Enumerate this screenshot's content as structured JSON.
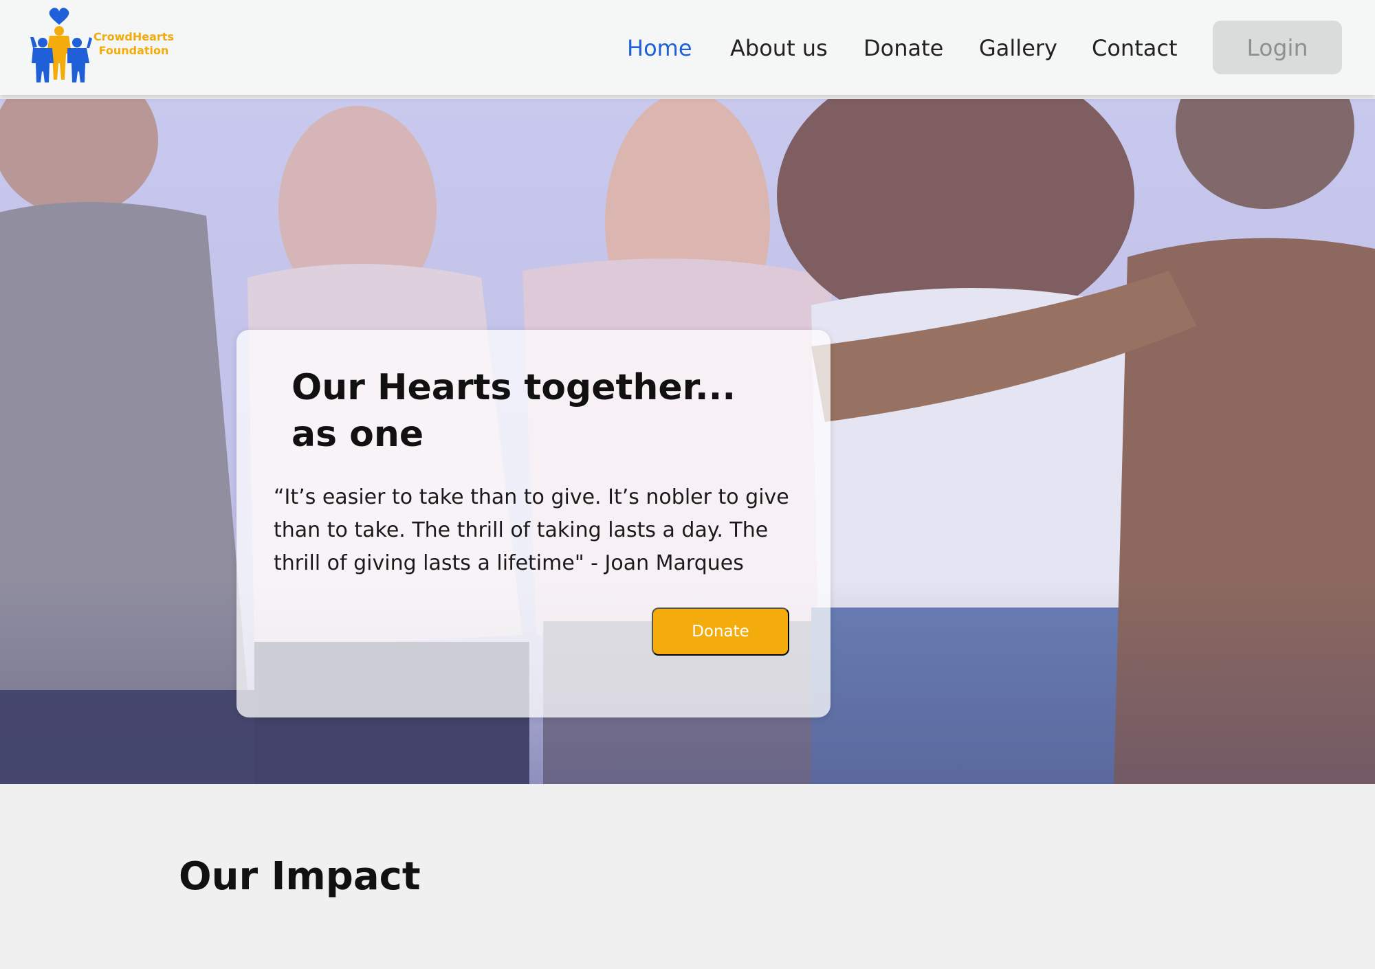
{
  "brand": {
    "name_line1": "CrowdHearts",
    "name_line2": "Foundation",
    "logo_icon": "heart-family-icon",
    "accent_color": "#f4ac0c",
    "primary_color": "#1f5fd8"
  },
  "nav": {
    "items": [
      {
        "label": "Home",
        "active": true
      },
      {
        "label": "About us",
        "active": false
      },
      {
        "label": "Donate",
        "active": false
      },
      {
        "label": "Gallery",
        "active": false
      },
      {
        "label": "Contact",
        "active": false
      }
    ],
    "login_label": "Login"
  },
  "hero": {
    "title": "Our Hearts together... as one",
    "quote": "“It’s easier to take than to give. It’s nobler to give than to take. The thrill of taking lasts a day. The thrill of giving lasts a lifetime\" - Joan Marques",
    "donate_label": "Donate"
  },
  "impact": {
    "title": "Our Impact"
  }
}
